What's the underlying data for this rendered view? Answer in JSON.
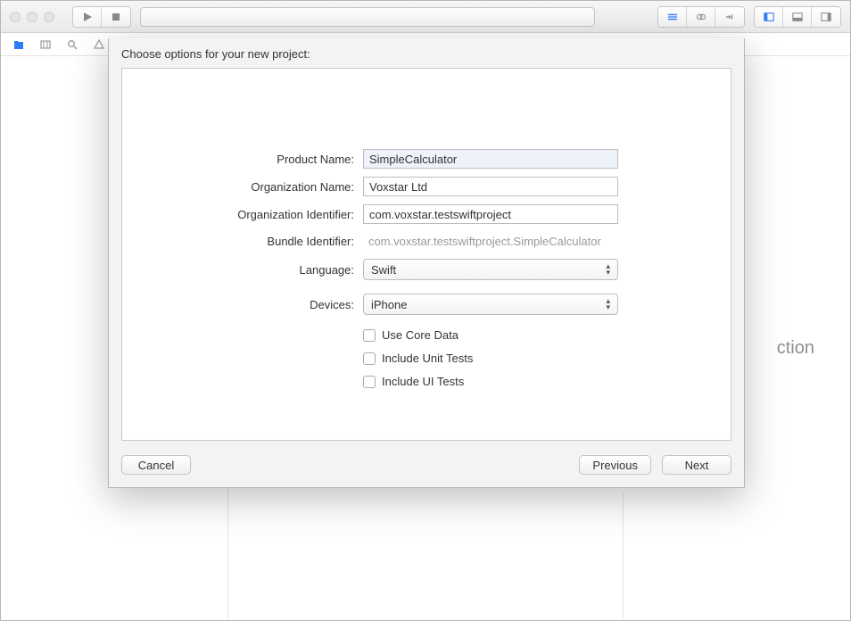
{
  "sheet": {
    "title": "Choose options for your new project:",
    "fields": {
      "productName": {
        "label": "Product Name:",
        "value": "SimpleCalculator"
      },
      "orgName": {
        "label": "Organization Name:",
        "value": "Voxstar Ltd"
      },
      "orgIdentifier": {
        "label": "Organization Identifier:",
        "value": "com.voxstar.testswiftproject"
      },
      "bundleIdentifier": {
        "label": "Bundle Identifier:",
        "value": "com.voxstar.testswiftproject.SimpleCalculator"
      },
      "language": {
        "label": "Language:",
        "value": "Swift"
      },
      "devices": {
        "label": "Devices:",
        "value": "iPhone"
      }
    },
    "checkboxes": {
      "coreData": "Use Core Data",
      "unitTests": "Include Unit Tests",
      "uiTests": "Include UI Tests"
    },
    "buttons": {
      "cancel": "Cancel",
      "previous": "Previous",
      "next": "Next"
    }
  },
  "background": {
    "partialText": "ction"
  }
}
